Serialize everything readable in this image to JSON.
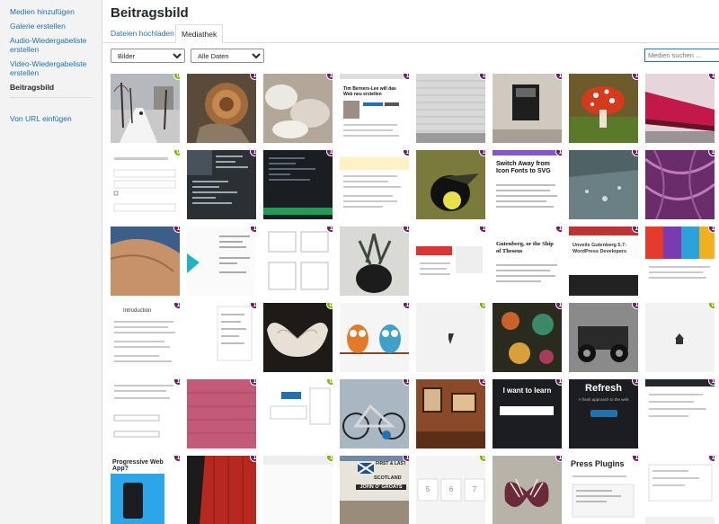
{
  "sidebar": {
    "items": [
      {
        "label": "Medien hinzufügen",
        "active": false
      },
      {
        "label": "Galerie erstellen",
        "active": false
      },
      {
        "label": "Audio-Wiedergabeliste erstellen",
        "active": false
      },
      {
        "label": "Video-Wiedergabeliste erstellen",
        "active": false
      },
      {
        "label": "Beitragsbild",
        "active": true
      }
    ],
    "url_item": "Von URL einfügen"
  },
  "header": {
    "title": "Beitragsbild",
    "tabs": [
      {
        "label": "Dateien hochladen",
        "active": false
      },
      {
        "label": "Mediathek",
        "active": true
      }
    ]
  },
  "toolbar": {
    "type_filter": "Bilder",
    "date_filter": "Alle Daten",
    "search_placeholder": "Medien suchen ..."
  },
  "colors": {
    "badge_purple": "#6d1e65",
    "badge_green": "#7ab800",
    "link": "#2271b1"
  },
  "media_grid": {
    "rows": [
      [
        "0",
        "1",
        "1",
        "1",
        "1",
        "1",
        "1",
        "1"
      ],
      [
        "0",
        "1",
        "1",
        "1",
        "1",
        "1",
        "1",
        "1"
      ],
      [
        "1",
        "1",
        "1",
        "1",
        "1",
        "1",
        "1",
        "1"
      ],
      [
        "1",
        "1",
        "0",
        "1",
        "0",
        "1",
        "1",
        "0"
      ],
      [
        "1",
        "1",
        "0",
        "1",
        "2",
        "1",
        "1",
        "1"
      ],
      [
        "1",
        "1",
        "1",
        "1",
        "0",
        "1",
        "1",
        "1"
      ]
    ],
    "texts": {
      "tech_title": "Tim Berners-Lee will das Web neu erstellen",
      "font_icons": "Switch Away from Icon Fonts to SVG",
      "gutenberg": "Gutenberg, or the Ship of Theseus",
      "gutenberg_side": "Unveils Gutenberg 5.7: WordPress Developers",
      "introduction": "Introduction",
      "refresh": "Refresh",
      "refresh_sub": "A fresh approach to the web",
      "want_to_learn": "I want to learn",
      "progressive": "Progressive Web App?",
      "press_plugins": "Press Plugins",
      "first_last": "FIRST & LAST",
      "scotland": "SCOTLAND",
      "john_o_groats": "JOHN O' GROATS",
      "numbers": [
        "5",
        "6",
        "7"
      ]
    }
  }
}
